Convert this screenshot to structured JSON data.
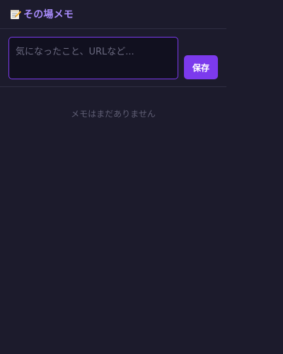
{
  "header": {
    "icon": "memo-pencil-icon",
    "title": "その場メモ"
  },
  "composer": {
    "placeholder": "気になったこと、URLなど...",
    "value": "",
    "save_label": "保存"
  },
  "memo_list": {
    "empty_message": "メモはまだありません",
    "items": []
  },
  "colors": {
    "background": "#1c1b2c",
    "accent": "#7c3aed",
    "title": "#a78bfa"
  }
}
